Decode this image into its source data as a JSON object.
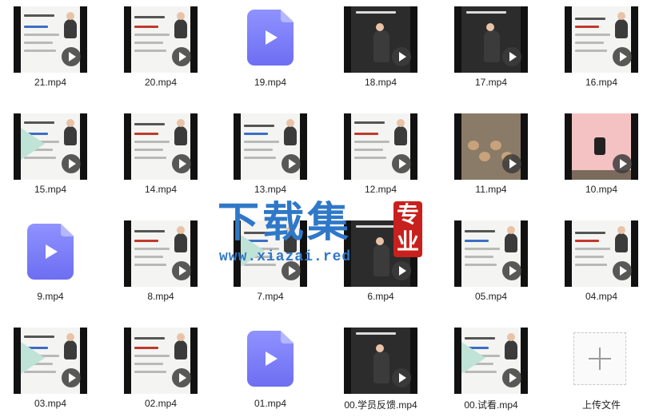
{
  "files": [
    {
      "name": "21.mp4",
      "kind": "video",
      "style": "doc"
    },
    {
      "name": "20.mp4",
      "kind": "video",
      "style": "doc"
    },
    {
      "name": "19.mp4",
      "kind": "file"
    },
    {
      "name": "18.mp4",
      "kind": "video",
      "style": "cam"
    },
    {
      "name": "17.mp4",
      "kind": "video",
      "style": "cam"
    },
    {
      "name": "16.mp4",
      "kind": "video",
      "style": "doc"
    },
    {
      "name": "15.mp4",
      "kind": "video",
      "style": "doc"
    },
    {
      "name": "14.mp4",
      "kind": "video",
      "style": "doc"
    },
    {
      "name": "13.mp4",
      "kind": "video",
      "style": "doc"
    },
    {
      "name": "12.mp4",
      "kind": "video",
      "style": "doc"
    },
    {
      "name": "11.mp4",
      "kind": "video",
      "style": "photo"
    },
    {
      "name": "10.mp4",
      "kind": "video",
      "style": "pink"
    },
    {
      "name": "9.mp4",
      "kind": "file"
    },
    {
      "name": "8.mp4",
      "kind": "video",
      "style": "doc"
    },
    {
      "name": "7.mp4",
      "kind": "video",
      "style": "doc"
    },
    {
      "name": "6.mp4",
      "kind": "video",
      "style": "cam"
    },
    {
      "name": "05.mp4",
      "kind": "video",
      "style": "doc"
    },
    {
      "name": "04.mp4",
      "kind": "video",
      "style": "doc"
    },
    {
      "name": "03.mp4",
      "kind": "video",
      "style": "doc"
    },
    {
      "name": "02.mp4",
      "kind": "video",
      "style": "doc"
    },
    {
      "name": "01.mp4",
      "kind": "file"
    },
    {
      "name": "00.学员反馈.mp4",
      "kind": "video",
      "style": "cam"
    },
    {
      "name": "00.试看.mp4",
      "kind": "video",
      "style": "doc"
    }
  ],
  "upload": {
    "label": "上传文件"
  },
  "watermark": {
    "title": "下载集",
    "url": "www.xiazai.red",
    "seal": "专业"
  },
  "colors": {
    "file_icon": "#7a7cf8",
    "watermark": "#2f78c8",
    "seal": "#c8201c"
  }
}
